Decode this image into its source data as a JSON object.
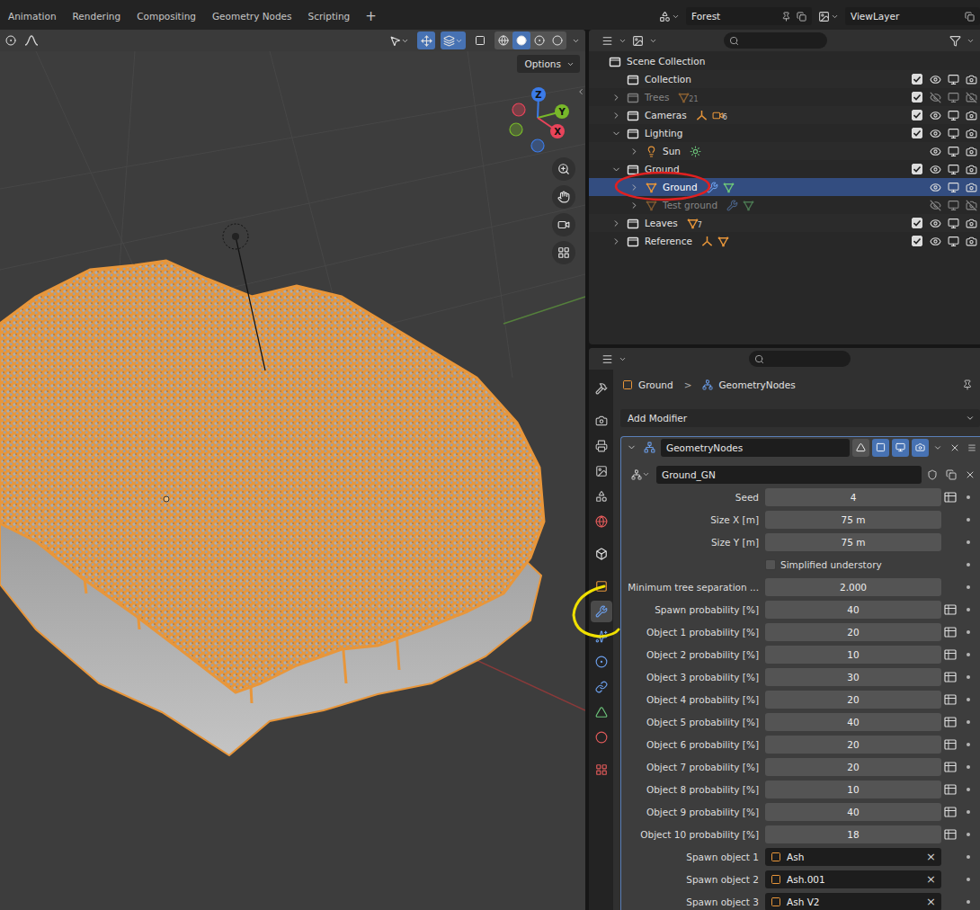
{
  "topbar": {
    "workspace_tabs": [
      {
        "label": "Animation",
        "selected": false
      },
      {
        "label": "Rendering",
        "selected": false
      },
      {
        "label": "Compositing",
        "selected": false
      },
      {
        "label": "Geometry Nodes",
        "selected": false
      },
      {
        "label": "Scripting",
        "selected": false
      }
    ],
    "add_workspace": "+",
    "scene": "Forest",
    "view_layer": "ViewLayer"
  },
  "viewport": {
    "options": "Options",
    "gizmo": [
      {
        "label": "Z",
        "color": "#3b7be8"
      },
      {
        "label": "Y",
        "color": "#78b82a"
      },
      {
        "label": "X",
        "color": "#e8445a"
      }
    ]
  },
  "outliner": {
    "rows": [
      {
        "label": "Scene Collection",
        "kind": "scene",
        "depth": 0,
        "expandable": false,
        "selected": false,
        "greyed": false,
        "badges": []
      },
      {
        "label": "Collection",
        "kind": "collection",
        "depth": 1,
        "expandable": false,
        "selected": false,
        "greyed": false,
        "checked": true,
        "visible": true,
        "renderable": true,
        "badges": []
      },
      {
        "label": "Trees",
        "kind": "collection",
        "depth": 1,
        "expandable": true,
        "expanded": false,
        "selected": false,
        "greyed": true,
        "checked": true,
        "visible": false,
        "renderable": false,
        "badges": [
          {
            "kind": "mesh",
            "count": "21"
          }
        ]
      },
      {
        "label": "Cameras",
        "kind": "collection",
        "depth": 1,
        "expandable": true,
        "expanded": false,
        "selected": false,
        "greyed": false,
        "checked": true,
        "visible": true,
        "renderable": true,
        "badges": [
          {
            "kind": "empty"
          },
          {
            "kind": "camera",
            "count": "6"
          }
        ]
      },
      {
        "label": "Lighting",
        "kind": "collection",
        "depth": 1,
        "expandable": true,
        "expanded": true,
        "selected": false,
        "greyed": false,
        "checked": true,
        "visible": true,
        "renderable": true,
        "badges": []
      },
      {
        "label": "Sun",
        "kind": "light",
        "depth": 2,
        "expandable": true,
        "expanded": false,
        "selected": false,
        "greyed": false,
        "visible": true,
        "renderable": true,
        "badges": [
          {
            "kind": "light_data"
          }
        ]
      },
      {
        "label": "Ground",
        "kind": "collection",
        "depth": 1,
        "expandable": true,
        "expanded": true,
        "selected": false,
        "greyed": false,
        "checked": true,
        "visible": true,
        "renderable": true,
        "badges": []
      },
      {
        "label": "Ground",
        "kind": "mesh",
        "depth": 2,
        "expandable": true,
        "expanded": false,
        "selected": true,
        "greyed": false,
        "visible": true,
        "renderable": true,
        "badges": [
          {
            "kind": "modifier"
          },
          {
            "kind": "mesh_data"
          }
        ]
      },
      {
        "label": "Test ground",
        "kind": "mesh",
        "depth": 2,
        "expandable": true,
        "expanded": false,
        "selected": false,
        "greyed": true,
        "visible": false,
        "renderable": false,
        "badges": [
          {
            "kind": "modifier"
          },
          {
            "kind": "mesh_data"
          }
        ]
      },
      {
        "label": "Leaves",
        "kind": "collection",
        "depth": 1,
        "expandable": true,
        "expanded": false,
        "selected": false,
        "greyed": false,
        "checked": true,
        "visible": true,
        "renderable": true,
        "badges": [
          {
            "kind": "mesh",
            "count": "7"
          }
        ]
      },
      {
        "label": "Reference",
        "kind": "collection",
        "depth": 1,
        "expandable": true,
        "expanded": false,
        "selected": false,
        "greyed": false,
        "checked": true,
        "visible": true,
        "renderable": true,
        "badges": [
          {
            "kind": "empty"
          },
          {
            "kind": "mesh"
          }
        ]
      }
    ]
  },
  "properties": {
    "tabs": [
      {
        "selected": false
      },
      {
        "selected": false
      },
      {
        "selected": false
      },
      {
        "selected": false
      },
      {
        "selected": false
      },
      {
        "selected": false
      },
      {
        "selected": false
      },
      {
        "selected": false
      },
      {
        "selected": true
      },
      {
        "selected": false
      },
      {
        "selected": false
      },
      {
        "selected": false
      },
      {
        "selected": false
      },
      {
        "selected": false
      },
      {
        "selected": false
      }
    ],
    "breadcrumb": [
      "Ground",
      "GeometryNodes"
    ],
    "breadcrumb_separator": ">",
    "add_modifier": "Add Modifier",
    "modifier": {
      "name": "GeometryNodes",
      "expanded": true,
      "show_on_cage": false,
      "show_in_editmode": true,
      "show_viewport": true,
      "show_render": true,
      "node_group": "Ground_GN"
    },
    "fields": [
      {
        "label": "Seed",
        "kind": "number",
        "value": "4",
        "attribute_toggle": true
      },
      {
        "label": "Size X [m]",
        "kind": "number",
        "value": "75 m",
        "attribute_toggle": false
      },
      {
        "label": "Size Y [m]",
        "kind": "number",
        "value": "75 m",
        "attribute_toggle": false
      },
      {
        "label": "Simplified understory",
        "kind": "checkbox",
        "checked": false
      },
      {
        "label": "Minimum tree separation ...",
        "kind": "number",
        "value": "2.000",
        "attribute_toggle": false
      },
      {
        "label": "Spawn probability [%]",
        "kind": "number",
        "value": "40",
        "attribute_toggle": true
      },
      {
        "label": "Object 1 probability [%]",
        "kind": "number",
        "value": "20",
        "attribute_toggle": true
      },
      {
        "label": "Object 2 probability [%]",
        "kind": "number",
        "value": "10",
        "attribute_toggle": true
      },
      {
        "label": "Object 3 probability [%]",
        "kind": "number",
        "value": "30",
        "attribute_toggle": true
      },
      {
        "label": "Object 4 probability [%]",
        "kind": "number",
        "value": "20",
        "attribute_toggle": true
      },
      {
        "label": "Object 5 probability [%]",
        "kind": "number",
        "value": "40",
        "attribute_toggle": true
      },
      {
        "label": "Object 6 probability [%]",
        "kind": "number",
        "value": "20",
        "attribute_toggle": true
      },
      {
        "label": "Object 7 probability [%]",
        "kind": "number",
        "value": "20",
        "attribute_toggle": true
      },
      {
        "label": "Object 8 probability [%]",
        "kind": "number",
        "value": "10",
        "attribute_toggle": true
      },
      {
        "label": "Object 9 probability [%]",
        "kind": "number",
        "value": "40",
        "attribute_toggle": true
      },
      {
        "label": "Object 10 probability [%]",
        "kind": "number",
        "value": "18",
        "attribute_toggle": true
      },
      {
        "label": "Spawn object 1",
        "kind": "object",
        "value": "Ash",
        "clear": "×"
      },
      {
        "label": "Spawn object 2",
        "kind": "object",
        "value": "Ash.001",
        "clear": "×"
      },
      {
        "label": "Spawn object 3",
        "kind": "object",
        "value": "Ash V2",
        "clear": "×"
      }
    ]
  }
}
